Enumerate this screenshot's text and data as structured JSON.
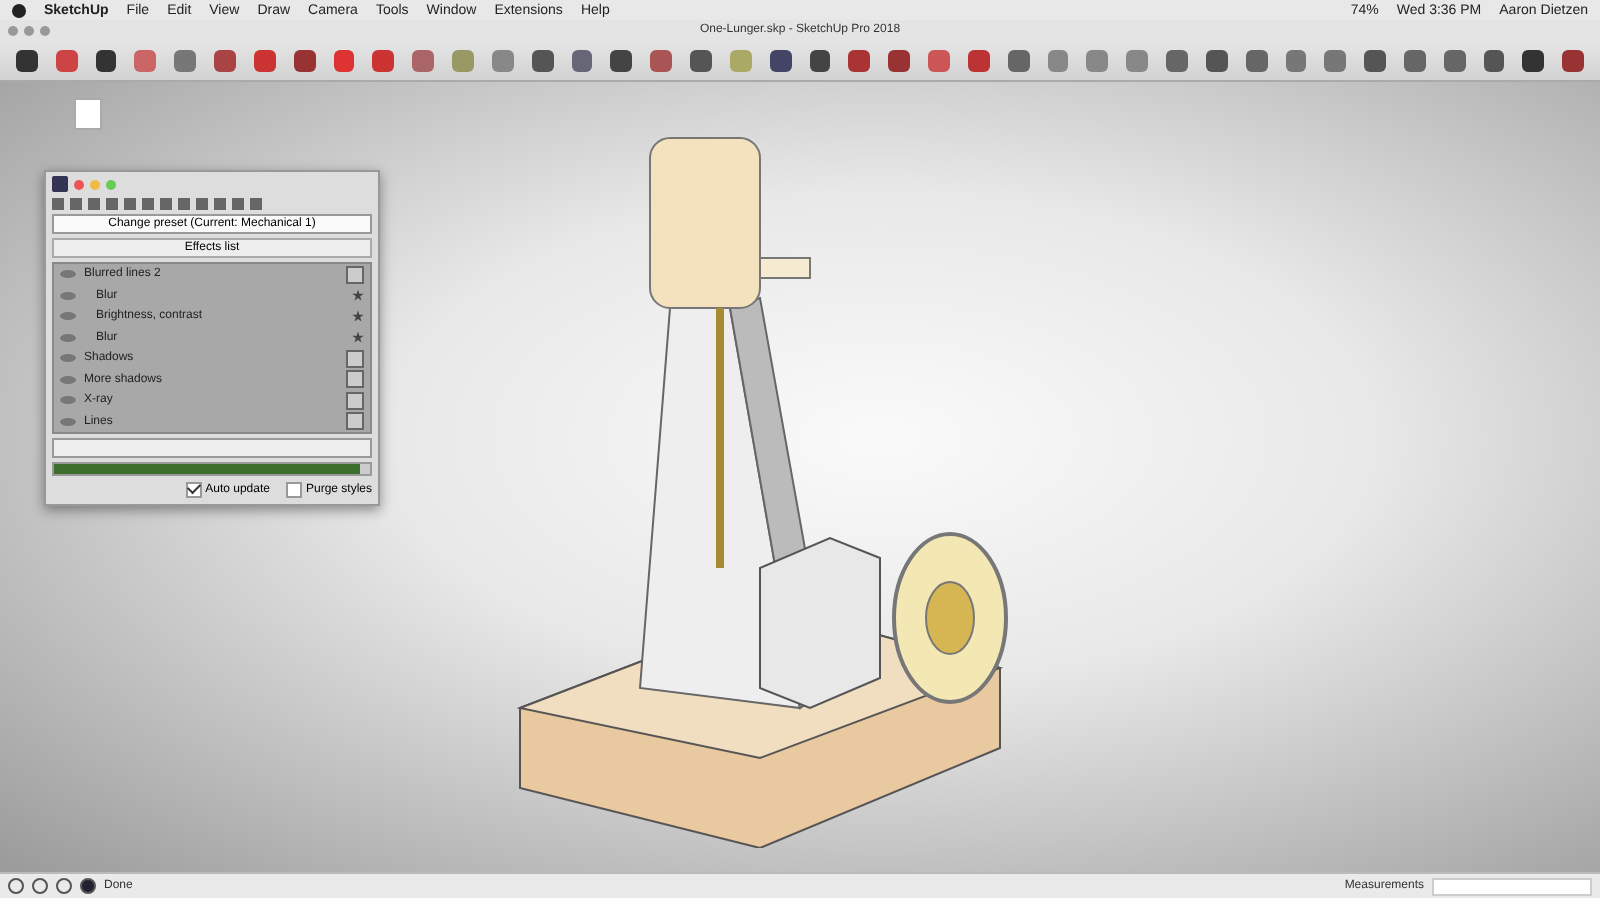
{
  "menu_bar": {
    "app_name": "SketchUp",
    "items": [
      "File",
      "Edit",
      "View",
      "Draw",
      "Camera",
      "Tools",
      "Window",
      "Extensions",
      "Help"
    ],
    "battery": "74%",
    "clock": "Wed 3:36 PM",
    "user": "Aaron Dietzen"
  },
  "window": {
    "title": "One-Lunger.skp - SketchUp Pro 2018"
  },
  "effects_panel": {
    "preset_button": "Change preset (Current: Mechanical 1)",
    "list_header": "Effects list",
    "effects": [
      {
        "kind": "group",
        "label": "Blurred lines 2"
      },
      {
        "kind": "sub",
        "label": "Blur"
      },
      {
        "kind": "sub",
        "label": "Brightness, contrast"
      },
      {
        "kind": "sub",
        "label": "Blur"
      },
      {
        "kind": "group",
        "label": "Shadows"
      },
      {
        "kind": "group",
        "label": "More shadows"
      },
      {
        "kind": "group",
        "label": "X-ray"
      },
      {
        "kind": "group",
        "label": "Lines"
      }
    ],
    "progress": {
      "level": 0.97
    },
    "options": [
      {
        "label": "Auto update",
        "checked": true
      },
      {
        "label": "Purge styles",
        "checked": false
      }
    ]
  },
  "status_bar": {
    "message": "Done",
    "measurements_label": "Measurements"
  }
}
